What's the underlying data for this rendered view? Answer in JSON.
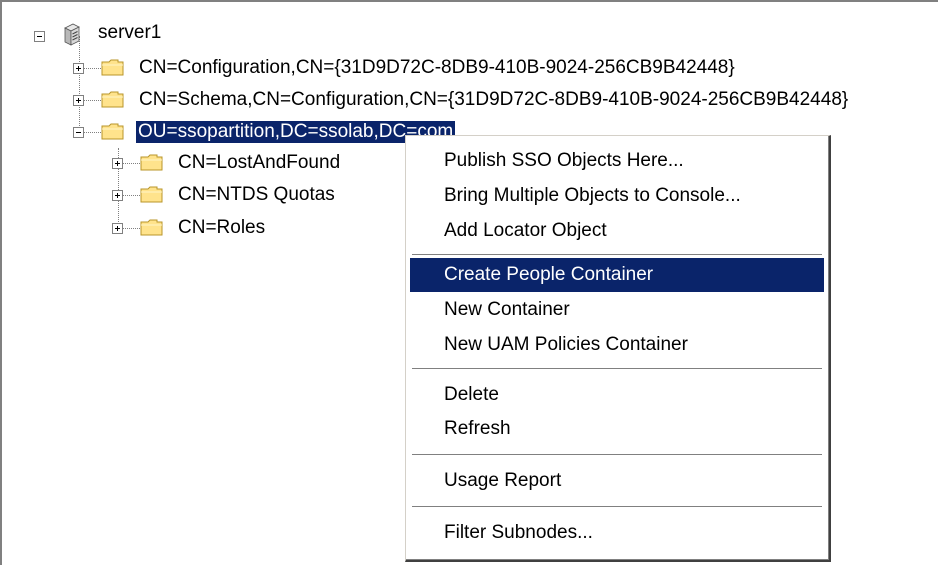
{
  "tree": {
    "root": {
      "label": "server1",
      "icon": "server-icon",
      "expanded": true
    },
    "children": [
      {
        "label": "CN=Configuration,CN={31D9D72C-8DB9-410B-9024-256CB9B42448}",
        "expanded": false
      },
      {
        "label": "CN=Schema,CN=Configuration,CN={31D9D72C-8DB9-410B-9024-256CB9B42448}",
        "expanded": false
      },
      {
        "label": "OU=ssopartition,DC=ssolab,DC=com",
        "expanded": true,
        "selected": true,
        "children": [
          {
            "label": "CN=LostAndFound",
            "expanded": false
          },
          {
            "label": "CN=NTDS Quotas",
            "expanded": false
          },
          {
            "label": "CN=Roles",
            "expanded": false
          }
        ]
      }
    ]
  },
  "context_menu": {
    "groups": [
      [
        "Publish SSO Objects Here...",
        "Bring Multiple Objects to Console...",
        "Add Locator Object"
      ],
      [
        "Create People Container",
        "New Container",
        "New UAM Policies Container"
      ],
      [
        "Delete",
        "Refresh"
      ],
      [
        "Usage Report"
      ],
      [
        "Filter Subnodes..."
      ]
    ],
    "highlighted": "Create People Container"
  },
  "colors": {
    "selection": "#0a246a",
    "folder_fill": "#ffe38c",
    "folder_edge": "#b8962a",
    "frame": "#808080"
  }
}
